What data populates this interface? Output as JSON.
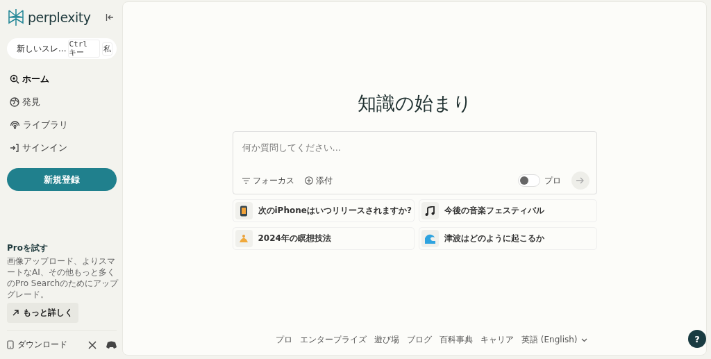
{
  "sidebar": {
    "logo": "perplexity",
    "new_thread": {
      "label": "新しいスレ...",
      "shortcut": "Ctrl キー",
      "key": "私"
    },
    "nav": [
      {
        "label": "ホーム",
        "kind": "home",
        "selected": true
      },
      {
        "label": "発見",
        "kind": "globe",
        "selected": false
      },
      {
        "label": "ライブラリ",
        "kind": "library",
        "selected": false
      },
      {
        "label": "サインイン",
        "kind": "signin",
        "selected": false
      }
    ],
    "signup": "新規登録",
    "pro": {
      "title": "Proを試す",
      "text": "画像アップロード、よりスマートなAI、その他もっと多くのPro Searchのためにアップグレード。",
      "button": "もっと詳しく"
    },
    "download": "ダウンロード"
  },
  "main": {
    "heading": "知識の始まり",
    "search": {
      "placeholder": "何か質問してください..."
    },
    "focus": "フォーカス",
    "attach": "添付",
    "pro_toggle": {
      "label": "プロ",
      "on": false
    },
    "suggestions": [
      {
        "text": "次のiPhoneはいつリリースされますか?",
        "kind": "phone"
      },
      {
        "text": "今後の音楽フェスティバル",
        "kind": "music"
      },
      {
        "text": "2024年の瞑想技法",
        "kind": "meditation"
      },
      {
        "text": "津波はどのように起こるか",
        "kind": "wave"
      }
    ],
    "footer": [
      "プロ",
      "エンタープライズ",
      "遊び場",
      "ブログ",
      "百科事典",
      "キャリア",
      "英語 (English)"
    ],
    "help": "?"
  }
}
